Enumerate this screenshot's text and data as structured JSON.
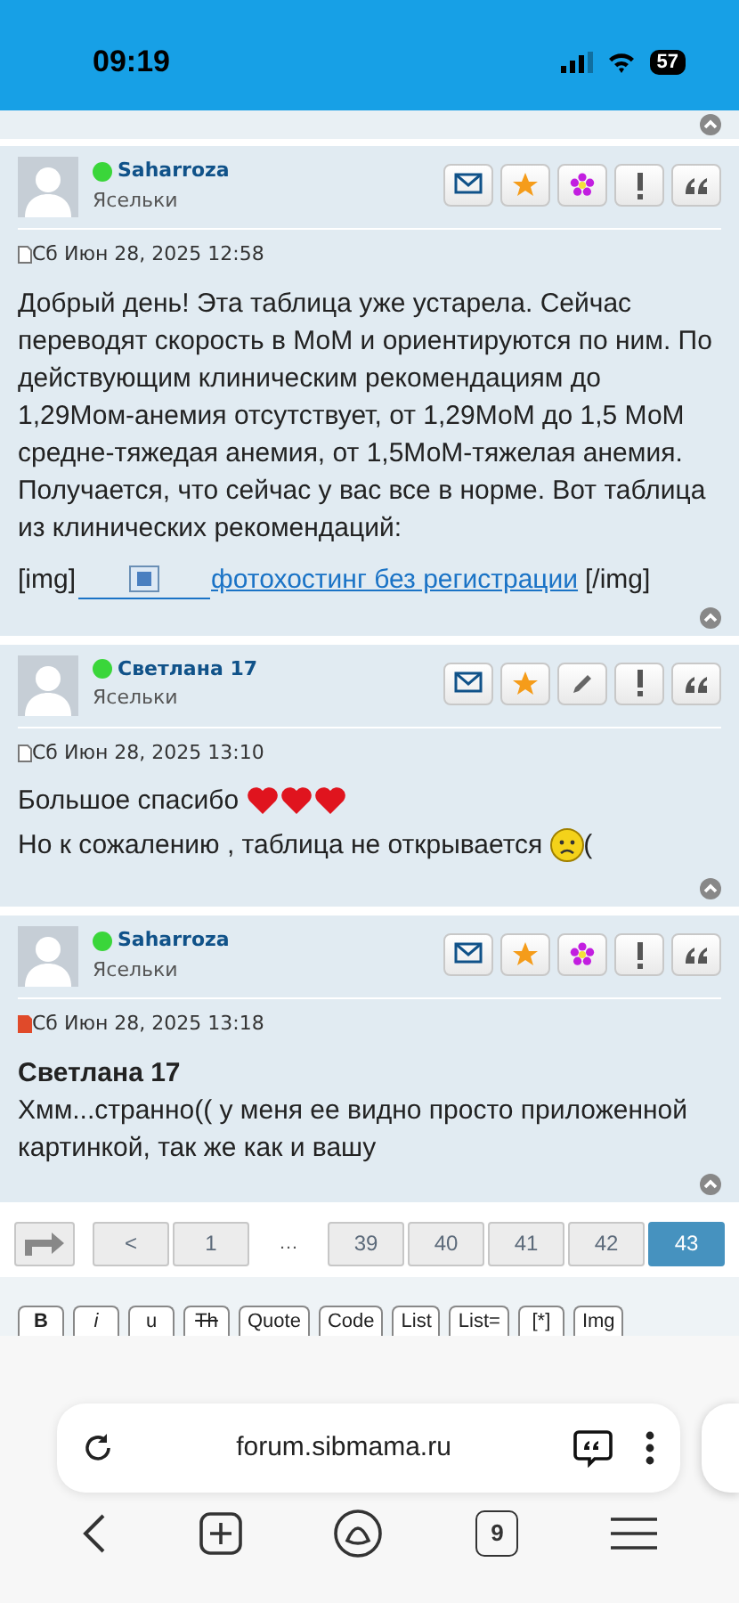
{
  "status_bar": {
    "time": "09:19",
    "battery": "57"
  },
  "posts": [
    {
      "author": "Saharroza",
      "online": true,
      "rank": "Ясельки",
      "actions": [
        {
          "kind": "pm"
        },
        {
          "kind": "star"
        },
        {
          "kind": "flower"
        },
        {
          "kind": "report"
        },
        {
          "kind": "quote"
        }
      ],
      "date": "Сб Июн 28, 2025 12:58",
      "unread": false,
      "body": [
        {
          "kind": "text",
          "text": "Добрый день! Эта таблица уже устарела. Сейчас переводят скорость в МоМ и ориентируются по ним. По действующим клиническим рекомендациям до 1,29Мом-анемия отсутствует, от 1,29МоМ до 1,5 МоМ средне-тяжедая анемия, от 1,5МоМ-тяжелая анемия. Получается, что сейчас у вас все в норме. Вот таблица из клинических рекомендаций:"
        },
        {
          "kind": "image_link",
          "before": "[img]",
          "link": "фотохостинг без регистрации",
          "after": "[/img]"
        }
      ]
    },
    {
      "author": "Светлана 17",
      "online": true,
      "rank": "Ясельки",
      "actions": [
        {
          "kind": "pm"
        },
        {
          "kind": "star"
        },
        {
          "kind": "edit"
        },
        {
          "kind": "report"
        },
        {
          "kind": "quote"
        }
      ],
      "date": "Сб Июн 28, 2025 13:10",
      "unread": false,
      "body": [
        {
          "kind": "text_hearts",
          "text": "Большое спасибо",
          "emoji": [
            {
              "kind": "heart"
            },
            {
              "kind": "heart"
            },
            {
              "kind": "heart"
            }
          ]
        },
        {
          "kind": "text_sad",
          "text": "Но к сожалению , таблица не открывается",
          "after": "("
        }
      ]
    },
    {
      "author": "Saharroza",
      "online": true,
      "rank": "Ясельки",
      "actions": [
        {
          "kind": "pm"
        },
        {
          "kind": "star"
        },
        {
          "kind": "flower"
        },
        {
          "kind": "report"
        },
        {
          "kind": "quote"
        }
      ],
      "date": "Сб Июн 28, 2025 13:18",
      "unread": true,
      "body": [
        {
          "kind": "quote_name",
          "text": "Светлана 17"
        },
        {
          "kind": "text",
          "text": "Хмм...странно(( у меня ее видно просто приложенной картинкой, так же как и вашу"
        }
      ]
    }
  ],
  "pagination": [
    {
      "kind": "page",
      "label": "<",
      "selected": false
    },
    {
      "kind": "page",
      "label": "1",
      "selected": false
    },
    {
      "kind": "gap",
      "label": "…"
    },
    {
      "kind": "page",
      "label": "39",
      "selected": false
    },
    {
      "kind": "page",
      "label": "40",
      "selected": false
    },
    {
      "kind": "page",
      "label": "41",
      "selected": false
    },
    {
      "kind": "page",
      "label": "42",
      "selected": false
    },
    {
      "kind": "page",
      "label": "43",
      "selected": true
    }
  ],
  "editor_buttons": [
    "B",
    "i",
    "u",
    "Th",
    "Quote",
    "Code",
    "List",
    "List=",
    "[*]",
    "Img"
  ],
  "browser": {
    "url": "forum.sibmama.ru",
    "tab_count": "9"
  }
}
